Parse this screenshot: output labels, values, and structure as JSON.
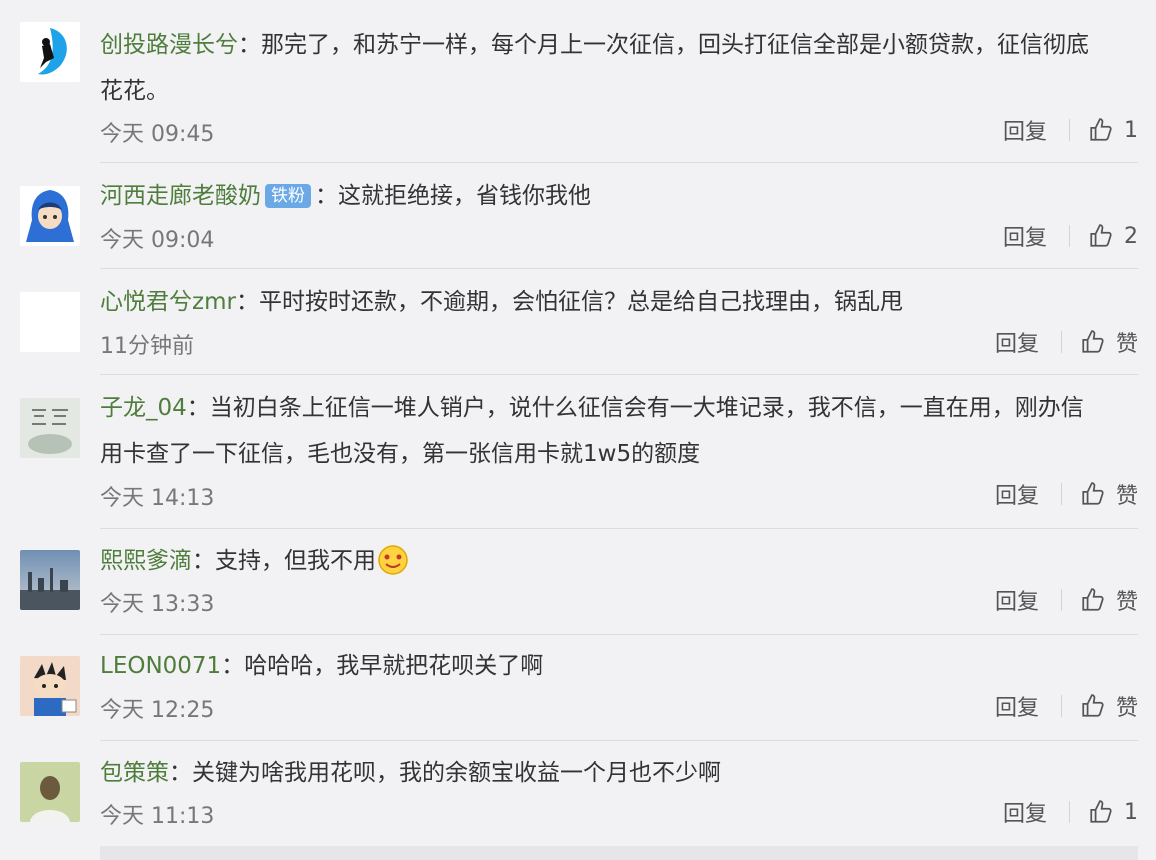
{
  "comments": [
    {
      "username": "创投路漫长兮",
      "badge": "",
      "lines": [
        "：那完了，和苏宁一样，每个月上一次征信，回头打征信全部是小额贷款，征信彻底",
        "花花。"
      ],
      "time": "今天 09:45",
      "reply": "回复",
      "like": "1"
    },
    {
      "username": "河西走廊老酸奶",
      "badge": "铁粉",
      "lines": [
        "：这就拒绝接，省钱你我他"
      ],
      "time": "今天 09:04",
      "reply": "回复",
      "like": "2"
    },
    {
      "username": "心悦君兮zmr",
      "badge": "",
      "lines": [
        "：平时按时还款，不逾期，会怕征信？总是给自己找理由，锅乱甩"
      ],
      "time": "11分钟前",
      "reply": "回复",
      "like": "赞"
    },
    {
      "username": "子龙_04",
      "badge": "",
      "lines": [
        "：当初白条上征信一堆人销户，说什么征信会有一大堆记录，我不信，一直在用，刚办信",
        "用卡查了一下征信，毛也没有，第一张信用卡就1w5的额度"
      ],
      "time": "今天 14:13",
      "reply": "回复",
      "like": "赞"
    },
    {
      "username": "熙熙爹滴",
      "badge": "",
      "lines": [
        "：支持，但我不用"
      ],
      "time": "今天 13:33",
      "reply": "回复",
      "like": "赞"
    },
    {
      "username": "LEON0071",
      "badge": "",
      "lines": [
        "：哈哈哈，我早就把花呗关了啊"
      ],
      "time": "今天 12:25",
      "reply": "回复",
      "like": "赞"
    },
    {
      "username": "包策策",
      "badge": "",
      "lines": [
        "：关键为啥我用花呗，我的余额宝收益一个月也不少啊"
      ],
      "time": "今天 11:13",
      "reply": "回复",
      "like": "1"
    }
  ]
}
